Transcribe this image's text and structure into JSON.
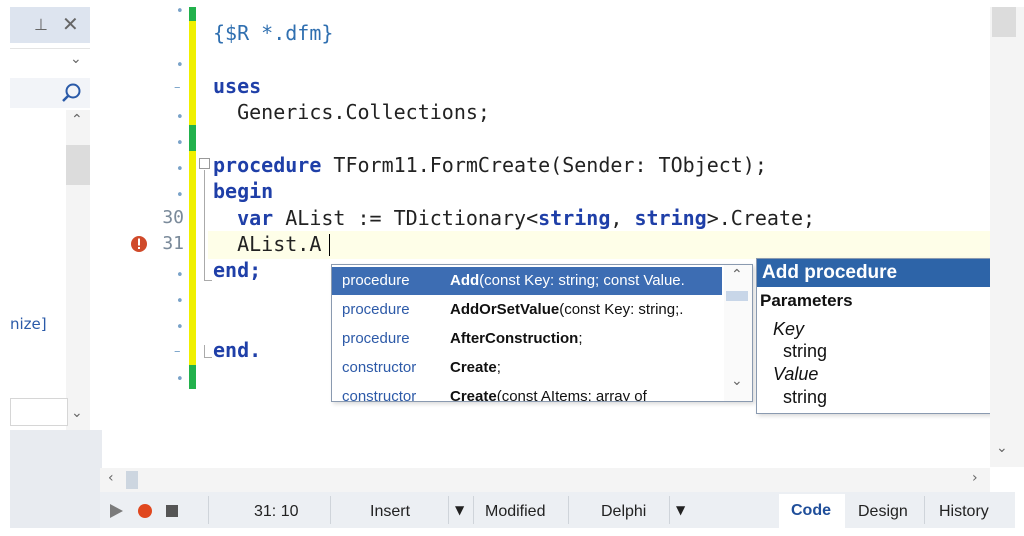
{
  "left_panel": {
    "pin_icon": "pin-icon",
    "close_icon": "close-icon",
    "truncated_text": "nize]"
  },
  "editor": {
    "lines": [
      {
        "number": "",
        "code": "{$R *.dfm}"
      },
      {
        "number": "",
        "code": ""
      },
      {
        "number": "",
        "code_kw": "uses"
      },
      {
        "number": "",
        "code": "  Generics.Collections;"
      },
      {
        "number": "",
        "code": ""
      },
      {
        "number": "",
        "kw": "procedure",
        "rest": " TForm11.FormCreate(Sender: TObject);"
      },
      {
        "number": "",
        "code_kw": "begin"
      },
      {
        "number": "30",
        "pre": "  ",
        "kw1": "var",
        "mid": " AList := TDictionary<",
        "kw2": "string",
        "comma": ", ",
        "kw3": "string",
        "rest": ">.Create;"
      },
      {
        "number": "31",
        "code": "  AList.A"
      },
      {
        "number": "",
        "code_kw": "end;"
      },
      {
        "number": "",
        "code": ""
      },
      {
        "number": "",
        "code_kw": "end."
      }
    ]
  },
  "completion": {
    "items": [
      {
        "kind": "procedure",
        "name": "Add",
        "params": "(const Key: string; const Value.",
        "selected": true
      },
      {
        "kind": "procedure",
        "name": "AddOrSetValue",
        "params": "(const Key: string;.",
        "selected": false
      },
      {
        "kind": "procedure",
        "name": "AfterConstruction",
        "params": ";",
        "selected": false
      },
      {
        "kind": "constructor",
        "name": "Create",
        "params": ";",
        "selected": false
      },
      {
        "kind": "constructor",
        "name": "Create",
        "params": "(const AItems: array of",
        "selected": false
      }
    ]
  },
  "hint": {
    "title": "Add procedure",
    "section": "Parameters",
    "params": [
      {
        "name": "Key",
        "type": "string"
      },
      {
        "name": "Value",
        "type": "string"
      }
    ]
  },
  "status": {
    "position": "31:  10",
    "insert": "Insert",
    "modified": "Modified",
    "language": "Delphi"
  },
  "tabs": {
    "code": "Code",
    "design": "Design",
    "history": "History"
  },
  "colors": {
    "keyword": "#1f3fa8",
    "selection": "#3d6db3",
    "hint_title": "#2d64a8",
    "change_bar_yellow": "#f0f000",
    "change_bar_green": "#22b14c",
    "error": "#d04a2a"
  }
}
